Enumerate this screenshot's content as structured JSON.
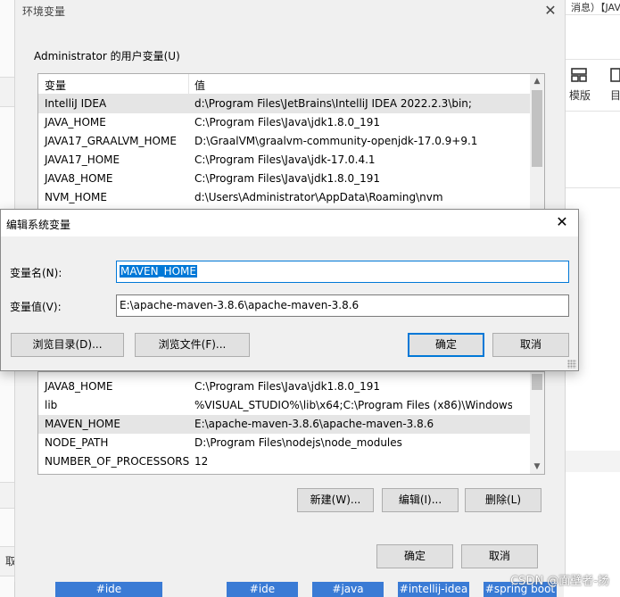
{
  "background": {
    "top_text": "消息）【JAVA",
    "toolbar_items": [
      {
        "icon": "layout-template-icon",
        "label": "模版"
      },
      {
        "icon": "list-icon",
        "label": "目"
      }
    ],
    "left_text": "取",
    "bottom_tags": [
      "#ide",
      "#ide",
      "#java",
      "#intellij-idea",
      "#spring boot"
    ],
    "watermark": "CSDN @面壁者-扬"
  },
  "env_window": {
    "title": "环境变量",
    "user_group_label": "Administrator 的用户变量(U)",
    "col_name": "变量",
    "col_value": "值",
    "user_vars": [
      {
        "name": "IntelliJ IDEA",
        "value": "d:\\Program Files\\JetBrains\\IntelliJ IDEA 2022.2.3\\bin;"
      },
      {
        "name": "JAVA_HOME",
        "value": "C:\\Program Files\\Java\\jdk1.8.0_191"
      },
      {
        "name": "JAVA17_GRAALVM_HOME",
        "value": "D:\\GraalVM\\graalvm-community-openjdk-17.0.9+9.1"
      },
      {
        "name": "JAVA17_HOME",
        "value": "C:\\Program Files\\Java\\jdk-17.0.4.1"
      },
      {
        "name": "JAVA8_HOME",
        "value": "C:\\Program Files\\Java\\jdk1.8.0_191"
      },
      {
        "name": "NVM_HOME",
        "value": "d:\\Users\\Administrator\\AppData\\Roaming\\nvm"
      }
    ],
    "system_vars": [
      {
        "name": "JAVA8_HOME",
        "value": "C:\\Program Files\\Java\\jdk1.8.0_191"
      },
      {
        "name": "lib",
        "value": "%VISUAL_STUDIO%\\lib\\x64;C:\\Program Files (x86)\\Windows ..."
      },
      {
        "name": "MAVEN_HOME",
        "value": "E:\\apache-maven-3.8.6\\apache-maven-3.8.6"
      },
      {
        "name": "NODE_PATH",
        "value": "D:\\Program Files\\nodejs\\node_modules"
      },
      {
        "name": "NUMBER_OF_PROCESSORS",
        "value": "12"
      }
    ],
    "new_button": "新建(W)...",
    "edit_button": "编辑(I)...",
    "delete_button": "删除(L)",
    "ok_button": "确定",
    "cancel_button": "取消"
  },
  "edit_dialog": {
    "title": "编辑系统变量",
    "name_label": "变量名(N):",
    "name_value": "MAVEN_HOME",
    "value_label": "变量值(V):",
    "value_value": "E:\\apache-maven-3.8.6\\apache-maven-3.8.6",
    "browse_dir_button": "浏览目录(D)...",
    "browse_file_button": "浏览文件(F)...",
    "ok_button": "确定",
    "cancel_button": "取消"
  },
  "colors": {
    "accent": "#0078d7",
    "selected_row": "#e5e5e5",
    "tag_blue": "#3a7bd5"
  }
}
